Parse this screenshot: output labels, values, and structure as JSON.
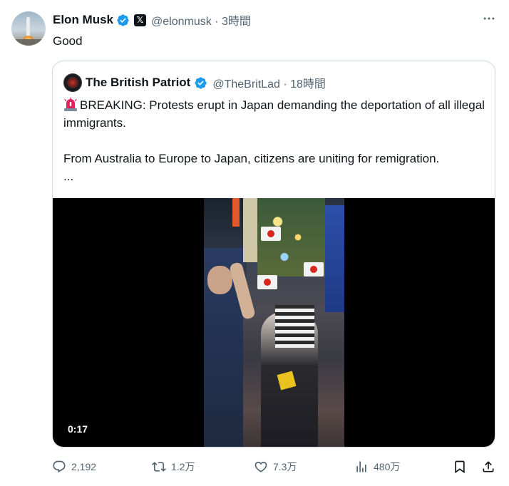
{
  "tweet": {
    "author_name": "Elon Musk",
    "handle_time": "@elonmusk · 3時間",
    "text": "Good",
    "affiliate_badge": "𝕏"
  },
  "quote": {
    "author_name": "The British Patriot",
    "handle_time": "@TheBritLad · 18時間",
    "line1": "BREAKING: Protests erupt in Japan demanding the deportation of all illegal immigrants.",
    "line2": "From Australia to Europe to Japan, citizens are uniting for remigration.",
    "ellipsis": "...",
    "video_duration": "0:17"
  },
  "actions": {
    "replies": "2,192",
    "retweets": "1.2万",
    "likes": "7.3万",
    "views": "480万"
  },
  "colors": {
    "text": "#0f1419",
    "muted": "#536471",
    "verified": "#1d9bf0",
    "border": "#cfd9de"
  },
  "icons": [
    "verified-icon",
    "x-affiliate-icon",
    "more-icon",
    "siren-icon",
    "reply-icon",
    "retweet-icon",
    "like-icon",
    "views-icon",
    "bookmark-icon",
    "share-icon"
  ]
}
